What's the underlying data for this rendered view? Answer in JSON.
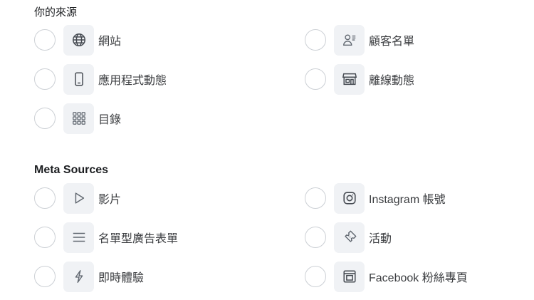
{
  "your_sources": {
    "title": "你的來源",
    "options": [
      {
        "label": "網站",
        "icon": "globe-icon"
      },
      {
        "label": "顧客名單",
        "icon": "customer-list-icon"
      },
      {
        "label": "應用程式動態",
        "icon": "mobile-app-icon"
      },
      {
        "label": "離線動態",
        "icon": "store-icon"
      },
      {
        "label": "目錄",
        "icon": "catalog-grid-icon"
      }
    ]
  },
  "meta_sources": {
    "title": "Meta Sources",
    "options": [
      {
        "label": "影片",
        "icon": "play-icon"
      },
      {
        "label": "Instagram 帳號",
        "icon": "instagram-icon"
      },
      {
        "label": "名單型廣告表單",
        "icon": "form-lines-icon"
      },
      {
        "label": "活動",
        "icon": "ticket-icon"
      },
      {
        "label": "即時體驗",
        "icon": "lightning-icon"
      },
      {
        "label": "Facebook 粉絲專頁",
        "icon": "page-icon"
      }
    ]
  },
  "colors": {
    "icon_bg": "#f0f2f5",
    "radio_border": "#ccd0d5",
    "icon_stroke": "#606770"
  }
}
